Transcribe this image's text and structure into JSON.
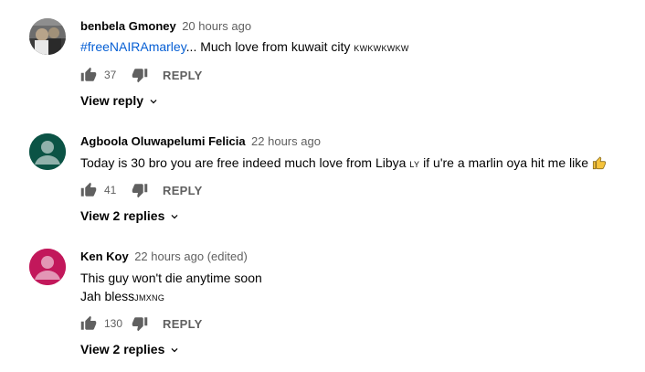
{
  "comments": [
    {
      "author": "benbela Gmoney",
      "time": "20 hours ago",
      "hashtag": "#freeNAIRAmarley",
      "text": "... Much love from kuwait city",
      "text_suffix": "KWKWKWKW",
      "likes": "37",
      "reply_label": "REPLY",
      "replies_label": "View reply",
      "avatar": "photo"
    },
    {
      "author": "Agboola Oluwapelumi Felicia",
      "time": "22 hours ago",
      "text": "Today is 30 bro you are free indeed much love from Libya",
      "text_mid": "LY",
      "text_end": "if u're a marlin oya hit me like",
      "emoji": "thumbs-up-emoji",
      "likes": "41",
      "reply_label": "REPLY",
      "replies_label": "View 2 replies",
      "avatar_color": "#0b5345"
    },
    {
      "author": "Ken Koy",
      "time": "22 hours ago (edited)",
      "line1": "This guy won't die anytime soon",
      "line2": "Jah bless",
      "line2_suffix": "JMXNG",
      "likes": "130",
      "reply_label": "REPLY",
      "replies_label": "View 2 replies",
      "avatar_color": "#c2185b"
    }
  ],
  "colors": {
    "hashtag": "#065fd4",
    "meta": "#606060",
    "text": "#030303"
  }
}
